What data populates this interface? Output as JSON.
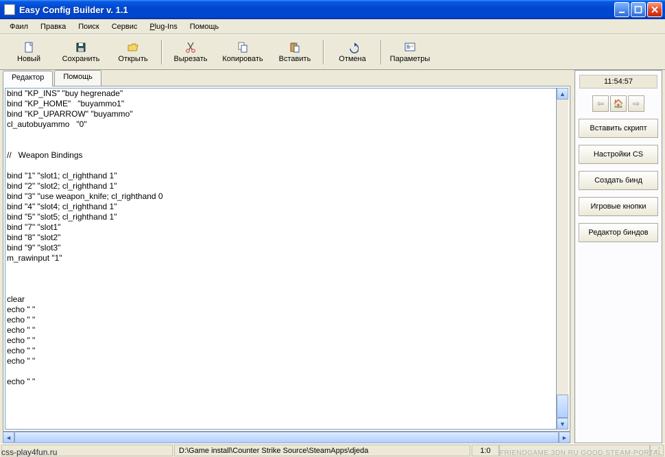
{
  "window": {
    "title": "Easy Config Builder v.  1.1"
  },
  "menu": {
    "file": "Фаил",
    "edit": "Правка",
    "search": "Поиск",
    "service": "Сервис",
    "plugins_pre": "P",
    "plugins_rest": "lug-Ins",
    "help": "Помощь"
  },
  "toolbar": {
    "new": "Новый",
    "save": "Сохранить",
    "open": "Открыть",
    "cut": "Вырезать",
    "copy": "Копировать",
    "paste": "Вставить",
    "undo": "Отмена",
    "params": "Параметры"
  },
  "tabs": {
    "editor": "Редактор",
    "help": "Помощь"
  },
  "editor_text": "bind \"KP_INS\" \"buy hegrenade\"\nbind \"KP_HOME\"   \"buyammo1\"\nbind \"KP_UPARROW\" \"buyammo\"\ncl_autobuyammo   \"0\"\n\n\n//   Weapon Bindings\n\nbind \"1\" \"slot1; cl_righthand 1\"\nbind \"2\" \"slot2; cl_righthand 1\"\nbind \"3\" \"use weapon_knife; cl_righthand 0\nbind \"4\" \"slot4; cl_righthand 1\"\nbind \"5\" \"slot5; cl_righthand 1\"\nbind \"7\" \"slot1\"\nbind \"8\" \"slot2\"\nbind \"9\" \"slot3\"\nm_rawinput \"1\"\n\n\n\nclear\necho \" \"\necho \" \"\necho \" \"\necho \" \"\necho \" \"\necho \" \"\n\necho \" \"",
  "side": {
    "clock": "11:54:57",
    "insert_script": "Вставить скрипт",
    "cs_settings": "Настройки CS",
    "create_bind": "Создать бинд",
    "game_buttons": "Игровые кнопки",
    "bind_editor": "Редактор биндов"
  },
  "status": {
    "path": "D:\\Game install\\Counter Strike Source\\SteamApps\\djeda",
    "pos": "1:0"
  },
  "watermark_left": "css-play4fun.ru",
  "watermark_right": "FRIENDGAME.3DN.RU GOOD.STEAM-PORTAL"
}
